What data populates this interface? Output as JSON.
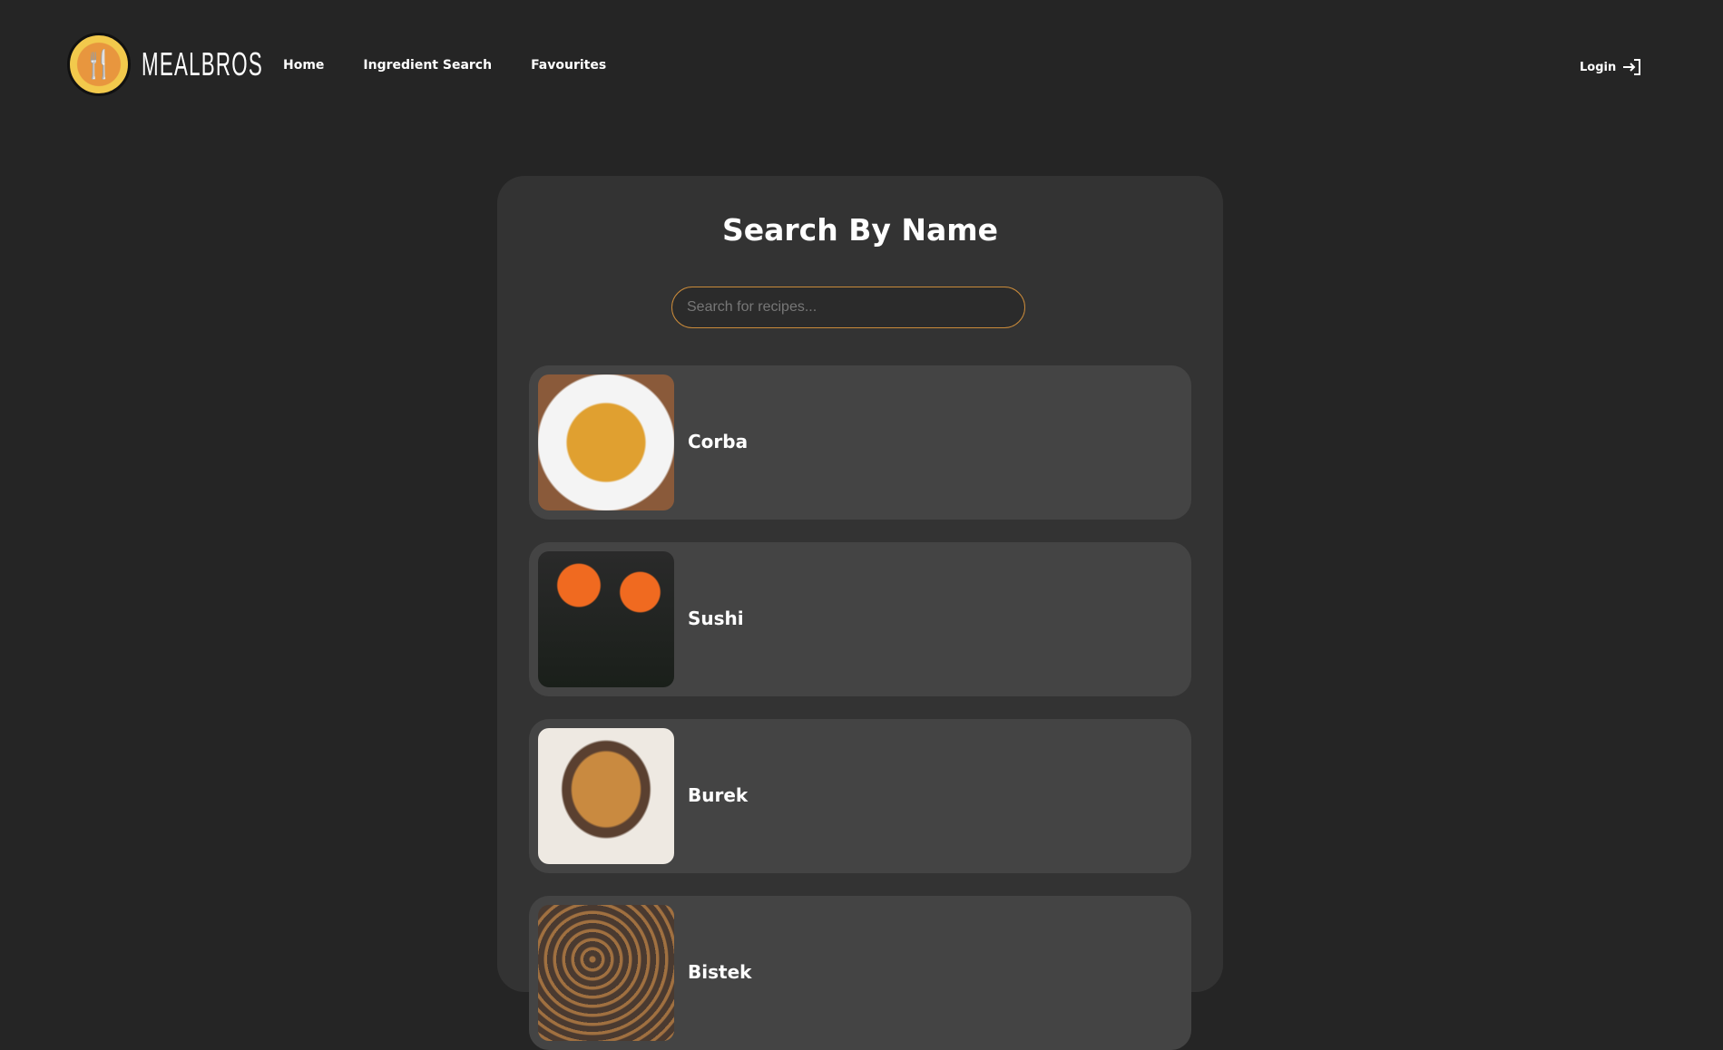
{
  "brand": {
    "name": "MEALBROS"
  },
  "nav": {
    "items": [
      {
        "label": "Home"
      },
      {
        "label": "Ingredient Search"
      },
      {
        "label": "Favourites"
      }
    ],
    "login": "Login"
  },
  "main": {
    "title": "Search By Name",
    "search": {
      "placeholder": "Search for recipes...",
      "value": ""
    },
    "results": [
      {
        "name": "Corba"
      },
      {
        "name": "Sushi"
      },
      {
        "name": "Burek"
      },
      {
        "name": "Bistek"
      }
    ]
  },
  "colors": {
    "accent": "#c98a3a",
    "background": "#252525",
    "card": "#333333",
    "item": "#444444"
  }
}
